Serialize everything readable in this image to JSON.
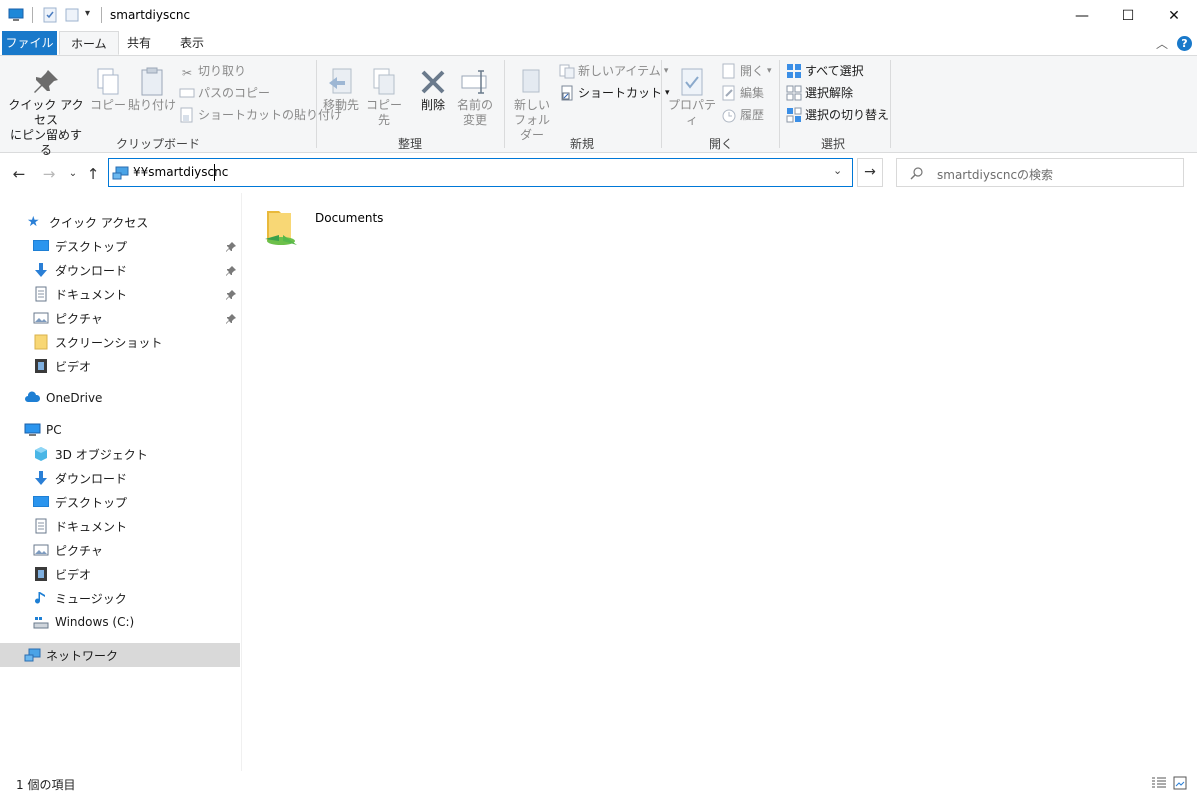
{
  "window": {
    "title": "smartdiyscnc",
    "controls": {
      "minimize": "—",
      "maximize": "☐",
      "close": "✕"
    }
  },
  "tabs": [
    {
      "label": "ファイル"
    },
    {
      "label": "ホーム"
    },
    {
      "label": "共有"
    },
    {
      "label": "表示"
    }
  ],
  "ribbon": {
    "clipboard": {
      "label": "クリップボード",
      "pin": "クイック アクセス にピン留めする",
      "pin_line1": "クイック アクセス",
      "pin_line2": "にピン留めする",
      "copy": "コピー",
      "paste": "貼り付け",
      "cut": "切り取り",
      "copy_path": "パスのコピー",
      "paste_shortcut": "ショートカットの貼り付け"
    },
    "organize": {
      "label": "整理",
      "move_to": "移動先",
      "copy_to": "コピー先",
      "delete": "削除",
      "rename_line1": "名前の",
      "rename_line2": "変更"
    },
    "new": {
      "label": "新規",
      "new_folder_line1": "新しい",
      "new_folder_line2": "フォルダー",
      "new_item": "新しいアイテム",
      "shortcut": "ショートカット"
    },
    "open": {
      "label": "開く",
      "properties": "プロパティ",
      "open": "開く",
      "edit": "編集",
      "history": "履歴"
    },
    "select": {
      "label": "選択",
      "select_all": "すべて選択",
      "select_none": "選択解除",
      "invert": "選択の切り替え"
    }
  },
  "address": {
    "path": "¥¥smartdiyscnc",
    "search_placeholder": "smartdiyscncの検索"
  },
  "navpane": {
    "quick_access": "クイック アクセス",
    "qa_items": [
      {
        "label": "デスクトップ",
        "icon": "desktop-icon",
        "pinned": true
      },
      {
        "label": "ダウンロード",
        "icon": "download-icon",
        "pinned": true
      },
      {
        "label": "ドキュメント",
        "icon": "document-icon",
        "pinned": true
      },
      {
        "label": "ピクチャ",
        "icon": "picture-icon",
        "pinned": true
      },
      {
        "label": "スクリーンショット",
        "icon": "folder-icon",
        "pinned": false
      },
      {
        "label": "ビデオ",
        "icon": "video-icon",
        "pinned": false
      }
    ],
    "onedrive": "OneDrive",
    "pc": "PC",
    "pc_items": [
      {
        "label": "3D オブジェクト",
        "icon": "3d-objects-icon"
      },
      {
        "label": "ダウンロード",
        "icon": "download-icon"
      },
      {
        "label": "デスクトップ",
        "icon": "desktop-icon"
      },
      {
        "label": "ドキュメント",
        "icon": "document-icon"
      },
      {
        "label": "ピクチャ",
        "icon": "picture-icon"
      },
      {
        "label": "ビデオ",
        "icon": "video-icon"
      },
      {
        "label": "ミュージック",
        "icon": "music-icon"
      },
      {
        "label": "Windows (C:)",
        "icon": "drive-icon"
      }
    ],
    "network": "ネットワーク"
  },
  "content": {
    "items": [
      {
        "label": "Documents",
        "icon": "shared-folder-icon"
      }
    ]
  },
  "status": {
    "count": "1 個の項目"
  },
  "colors": {
    "accent": "#1979ca",
    "selection": "#d9d9d9",
    "focus_border": "#0078d7"
  }
}
